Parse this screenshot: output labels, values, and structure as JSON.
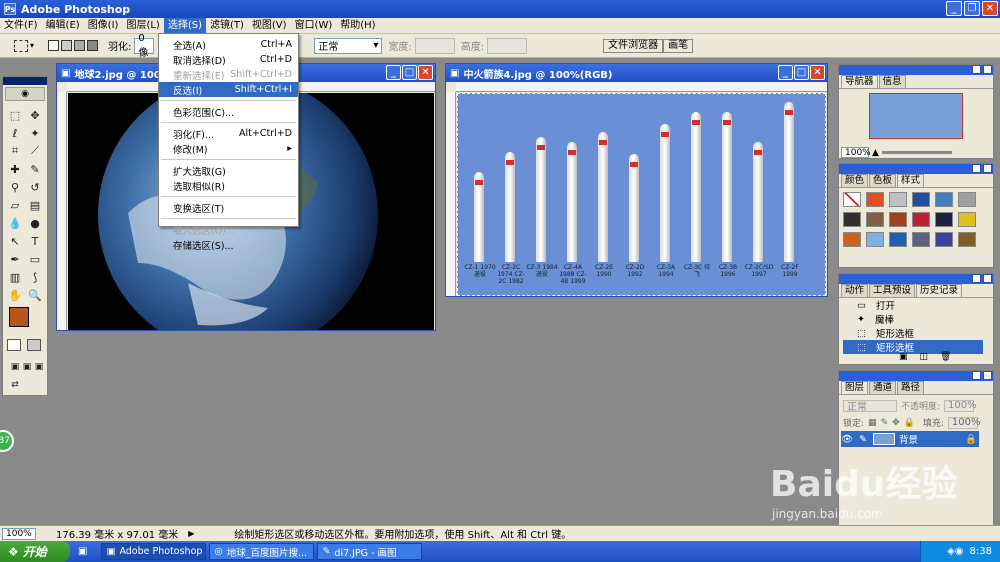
{
  "app": {
    "title": "Adobe Photoshop"
  },
  "menubar": [
    {
      "label": "文件(F)"
    },
    {
      "label": "编辑(E)"
    },
    {
      "label": "图像(I)"
    },
    {
      "label": "图层(L)"
    },
    {
      "label": "选择(S)"
    },
    {
      "label": "滤镜(T)"
    },
    {
      "label": "视图(V)"
    },
    {
      "label": "窗口(W)"
    },
    {
      "label": "帮助(H)"
    }
  ],
  "options": {
    "feather_label": "羽化:",
    "feather_value": "0 像",
    "style_value": "正常",
    "width_label": "宽度:",
    "height_label": "高度:",
    "file_browser_tab": "文件浏览器",
    "brushes_tab": "画笔"
  },
  "select_menu": {
    "items": [
      {
        "label": "全选(A)",
        "shortcut": "Ctrl+A",
        "state": "normal"
      },
      {
        "label": "取消选择(D)",
        "shortcut": "Ctrl+D",
        "state": "normal"
      },
      {
        "label": "重新选择(E)",
        "shortcut": "Shift+Ctrl+D",
        "state": "disabled"
      },
      {
        "label": "反选(I)",
        "shortcut": "Shift+Ctrl+I",
        "state": "highlighted"
      },
      {
        "label": "色彩范围(C)...",
        "shortcut": "",
        "state": "normal"
      },
      {
        "label": "羽化(F)...",
        "shortcut": "Alt+Ctrl+D",
        "state": "normal"
      },
      {
        "label": "修改(M)",
        "shortcut": "▸",
        "state": "normal"
      },
      {
        "label": "扩大选取(G)",
        "shortcut": "",
        "state": "normal"
      },
      {
        "label": "选取相似(R)",
        "shortcut": "",
        "state": "normal"
      },
      {
        "label": "变换选区(T)",
        "shortcut": "",
        "state": "normal"
      },
      {
        "label": "载入选区(O)...",
        "shortcut": "",
        "state": "disabled"
      },
      {
        "label": "存储选区(S)...",
        "shortcut": "",
        "state": "normal"
      }
    ]
  },
  "doc1": {
    "title": "地球2.jpg @ 100%"
  },
  "doc2": {
    "title": "中火箭族4.jpg @ 100%(RGB)",
    "rockets": [
      {
        "name": "CZ-1",
        "year": "1970",
        "extra": "退役"
      },
      {
        "name": "CZ-2C",
        "year": "1974",
        "extra": "CZ-2C 1982"
      },
      {
        "name": "CZ-3",
        "year": "1984",
        "extra": "退役"
      },
      {
        "name": "CZ-4A",
        "year": "1988",
        "extra": "CZ-4B 1999"
      },
      {
        "name": "CZ-2E",
        "year": "1990",
        "extra": ""
      },
      {
        "name": "CZ-2D",
        "year": "1992",
        "extra": ""
      },
      {
        "name": "CZ-3A",
        "year": "1994",
        "extra": ""
      },
      {
        "name": "CZ-3C",
        "year": "待飞",
        "extra": ""
      },
      {
        "name": "CZ-3B",
        "year": "1996",
        "extra": ""
      },
      {
        "name": "CZ-2C/SD",
        "year": "1997",
        "extra": ""
      },
      {
        "name": "CZ-2F",
        "year": "1999",
        "extra": ""
      }
    ]
  },
  "navigator": {
    "tabs": [
      "导航器",
      "信息"
    ],
    "zoom": "100%"
  },
  "swatches": {
    "tabs": [
      "颜色",
      "色板",
      "样式"
    ]
  },
  "history": {
    "tabs": [
      "动作",
      "工具预设",
      "历史记录"
    ],
    "items": [
      "打开",
      "魔棒",
      "矩形选框",
      "矩形选框"
    ]
  },
  "layers": {
    "tabs": [
      "图层",
      "通道",
      "路径"
    ],
    "blend_mode": "正常",
    "opacity_label": "不透明度:",
    "opacity_value": "100%",
    "lock_label": "锁定:",
    "fill_label": "填充:",
    "fill_value": "100%",
    "layer_name": "背景"
  },
  "status": {
    "zoom": "100%",
    "doc_size": "176.39 毫米 x 97.01 毫米",
    "hint": "绘制矩形选区或移动选区外框。要用附加选项，使用 Shift、Alt 和 Ctrl 键。"
  },
  "taskbar": {
    "start": "开始",
    "tasks": [
      "Adobe Photoshop",
      "地球_百度图片搜...",
      "di7.JPG - 画图"
    ],
    "clock": "8:38"
  },
  "watermark": {
    "text": "Baidu经验",
    "url": "jingyan.baidu.com"
  },
  "badge": {
    "text": "37"
  },
  "colors": {
    "foreground": "#b5561a",
    "background": "#ffffff",
    "accent": "#316ac5"
  }
}
